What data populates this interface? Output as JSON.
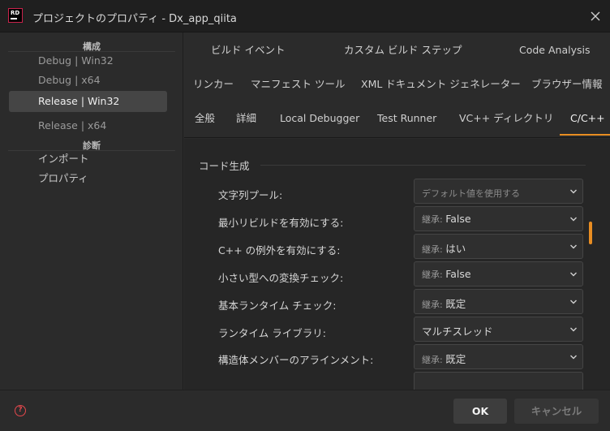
{
  "window": {
    "logo_text": "RD",
    "title": "プロジェクトのプロパティ - Dx_app_qiita"
  },
  "sidebar": {
    "groups": [
      {
        "label": "構成"
      },
      {
        "label": "診断"
      }
    ],
    "items": [
      {
        "label": "Debug | Win32"
      },
      {
        "label": "Debug | x64"
      },
      {
        "label": "Release | Win32"
      },
      {
        "label": "Release | x64"
      },
      {
        "label": "インポート"
      },
      {
        "label": "プロパティ"
      }
    ],
    "selected": "Release | Win32"
  },
  "tabs": {
    "row1": [
      {
        "label": "ビルド イベント"
      },
      {
        "label": "カスタム ビルド ステップ"
      },
      {
        "label": "Code Analysis"
      }
    ],
    "row2": [
      {
        "label": "リンカー"
      },
      {
        "label": "マニフェスト ツール"
      },
      {
        "label": "XML ドキュメント ジェネレーター"
      },
      {
        "label": "ブラウザー情報"
      }
    ],
    "row3": [
      {
        "label": "全般"
      },
      {
        "label": "詳細"
      },
      {
        "label": "Local Debugger"
      },
      {
        "label": "Test Runner"
      },
      {
        "label": "VC++ ディレクトリ"
      },
      {
        "label": "C/C++"
      }
    ],
    "active": "C/C++"
  },
  "content": {
    "section_title": "コード生成",
    "properties": [
      {
        "label": "文字列プール:",
        "value": "デフォルト値を使用する",
        "inherited_prefix": ""
      },
      {
        "label": "最小リビルドを有効にする:",
        "value": "False",
        "inherited_prefix": "継承: "
      },
      {
        "label": "C++ の例外を有効にする:",
        "value": "はい",
        "inherited_prefix": "継承: "
      },
      {
        "label": "小さい型への変換チェック:",
        "value": "False",
        "inherited_prefix": "継承: "
      },
      {
        "label": "基本ランタイム チェック:",
        "value": "既定",
        "inherited_prefix": "継承: "
      },
      {
        "label": "ランタイム ライブラリ:",
        "value": "マルチスレッド",
        "inherited_prefix": ""
      },
      {
        "label": "構造体メンバーのアラインメント:",
        "value": "既定",
        "inherited_prefix": "継承: "
      }
    ]
  },
  "footer": {
    "help_glyph": "?",
    "ok_label": "OK",
    "cancel_label": "キャンセル"
  },
  "colors": {
    "accent": "#e88d22",
    "background": "#2b2b2b",
    "help": "#e5484d"
  }
}
